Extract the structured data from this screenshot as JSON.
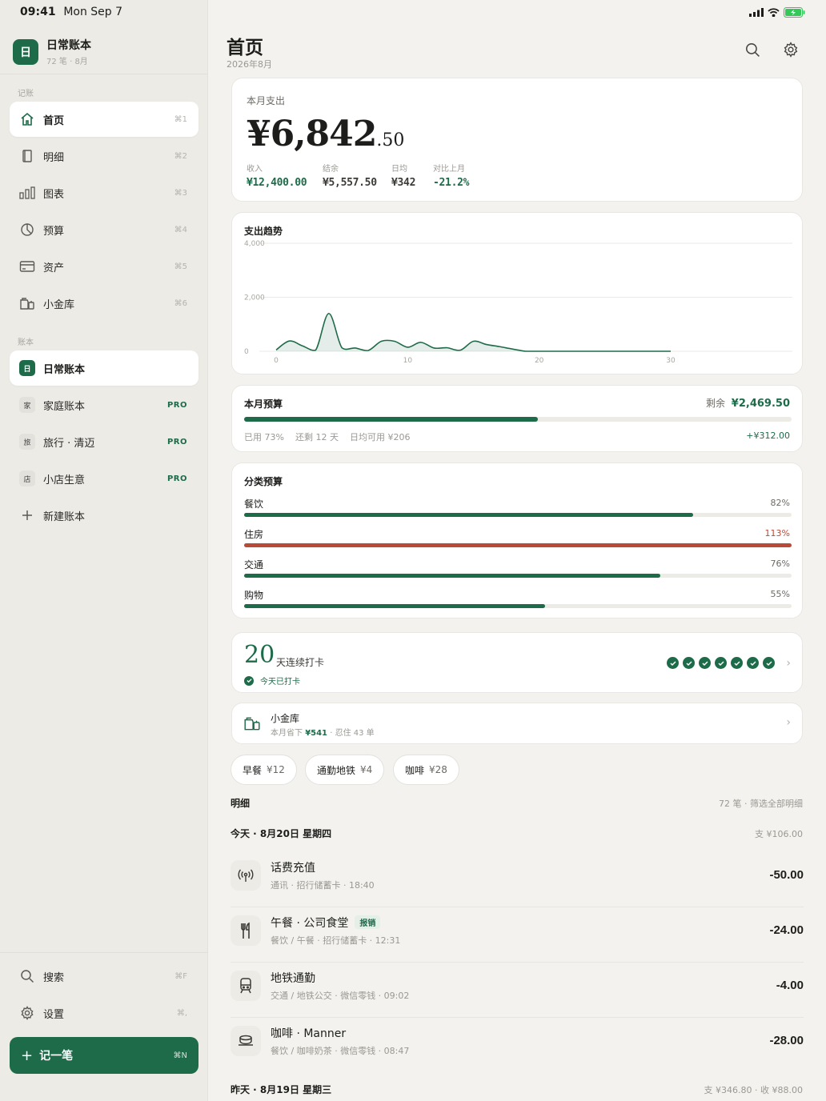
{
  "status": {
    "time": "09:41",
    "date": "Mon Sep 7"
  },
  "sidebar": {
    "book": {
      "logo": "日",
      "name": "日常账本",
      "sub": "72 笔 · 8月"
    },
    "section_record": "记账",
    "nav": [
      {
        "label": "首页",
        "shortcut": "⌘1",
        "icon": "home-icon"
      },
      {
        "label": "明细",
        "shortcut": "⌘2",
        "icon": "book-icon"
      },
      {
        "label": "图表",
        "shortcut": "⌘3",
        "icon": "bar-chart-icon"
      },
      {
        "label": "预算",
        "shortcut": "⌘4",
        "icon": "pie-icon"
      },
      {
        "label": "资产",
        "shortcut": "⌘5",
        "icon": "card-icon"
      },
      {
        "label": "小金库",
        "shortcut": "⌘6",
        "icon": "vault-icon"
      }
    ],
    "section_books": "账本",
    "books": [
      {
        "badge": "日",
        "label": "日常账本",
        "pro": ""
      },
      {
        "badge": "家",
        "label": "家庭账本",
        "pro": "PRO"
      },
      {
        "badge": "旅",
        "label": "旅行 · 清迈",
        "pro": "PRO"
      },
      {
        "badge": "店",
        "label": "小店生意",
        "pro": "PRO"
      }
    ],
    "new_book": "新建账本",
    "search": {
      "label": "搜索",
      "shortcut": "⌘F"
    },
    "settings": {
      "label": "设置",
      "shortcut": "⌘,"
    },
    "add": {
      "label": "记一笔",
      "shortcut": "⌘N"
    }
  },
  "header": {
    "title": "首页",
    "subtitle": "2026年8月"
  },
  "summary": {
    "label": "本月支出",
    "amount_main": "¥6,842",
    "amount_cents": ".50",
    "stats": [
      {
        "label": "收入",
        "value": "¥12,400.00",
        "color": "#1e6b4a"
      },
      {
        "label": "结余",
        "value": "¥5,557.50",
        "color": "#3d3b37"
      },
      {
        "label": "日均",
        "value": "¥342",
        "color": "#3d3b37"
      },
      {
        "label": "对比上月",
        "value": "-21.2%",
        "color": "#1e6b4a"
      }
    ]
  },
  "trend": {
    "title": "支出趋势"
  },
  "chart_data": {
    "type": "area",
    "title": "支出趋势",
    "x": [
      0,
      1,
      2,
      3,
      4,
      5,
      6,
      7,
      8,
      9,
      10,
      11,
      12,
      13,
      14,
      15,
      16,
      17,
      18,
      19,
      20,
      21,
      22,
      23,
      24,
      25,
      26,
      27,
      28,
      29,
      30
    ],
    "values": [
      50,
      380,
      200,
      40,
      1400,
      130,
      120,
      30,
      370,
      370,
      150,
      330,
      120,
      130,
      40,
      370,
      250,
      170,
      80,
      0,
      0,
      0,
      0,
      0,
      0,
      0,
      0,
      0,
      0,
      0,
      0
    ],
    "xticks": [
      "0",
      "10",
      "20",
      "30"
    ],
    "yticks": [
      "0",
      "2,000",
      "4,000"
    ],
    "ylim": [
      0,
      4000
    ],
    "xlim": [
      0,
      30
    ],
    "grid": true,
    "color": "#1e6b4a"
  },
  "budget": {
    "title": "本月预算",
    "remaining_label": "剩余",
    "remaining": "¥2,469.50",
    "progress": 0.73,
    "used": "已用 73%",
    "days_left": "还剩 12 天",
    "daily": "日均可用 ¥206",
    "delta": "+¥312.00"
  },
  "categories": {
    "title": "分类预算",
    "items": [
      {
        "name": "餐饮",
        "pct": "82%",
        "ratio": 0.82,
        "color": "#1e6b4a",
        "pct_color": "#6c6a65"
      },
      {
        "name": "住房",
        "pct": "113%",
        "ratio": 1.0,
        "color": "#b94a38",
        "pct_color": "#b94a38"
      },
      {
        "name": "交通",
        "pct": "76%",
        "ratio": 0.76,
        "color": "#1e6b4a",
        "pct_color": "#6c6a65"
      },
      {
        "name": "购物",
        "pct": "55%",
        "ratio": 0.55,
        "color": "#1e6b4a",
        "pct_color": "#6c6a65"
      }
    ]
  },
  "streak": {
    "days": "20",
    "unit": "天连续打卡",
    "today": "今天已打卡",
    "checks": 7
  },
  "vault": {
    "title": "小金库",
    "sub_prefix": "本月省下",
    "saved": "¥541",
    "sub_suffix": "· 忍住 43 单"
  },
  "chips": [
    {
      "label": "早餐",
      "value": "¥12"
    },
    {
      "label": "通勤地铁",
      "value": "¥4"
    },
    {
      "label": "咖啡",
      "value": "¥28"
    }
  ],
  "detail": {
    "title": "明细",
    "meta": "72 笔 · 筛选全部明细"
  },
  "today": {
    "label": "今天 · 8月20日 星期四",
    "total": "支 ¥106.00"
  },
  "transactions": [
    {
      "icon": "antenna-icon",
      "title": "话费充值",
      "tag": "",
      "sub": "通讯 · 招行储蓄卡 · 18:40",
      "amount": "-50.00"
    },
    {
      "icon": "utensils-icon",
      "title": "午餐 · 公司食堂",
      "tag": "报销",
      "sub": "餐饮 / 午餐 · 招行储蓄卡 · 12:31",
      "amount": "-24.00"
    },
    {
      "icon": "train-icon",
      "title": "地铁通勤",
      "tag": "",
      "sub": "交通 / 地铁公交 · 微信零钱 · 09:02",
      "amount": "-4.00"
    },
    {
      "icon": "coffee-icon",
      "title": "咖啡 · Manner",
      "tag": "",
      "sub": "餐饮 / 咖啡奶茶 · 微信零钱 · 08:47",
      "amount": "-28.00"
    }
  ],
  "yesterday": {
    "label": "昨天 · 8月19日 星期三",
    "total": "支 ¥346.80 · 收 ¥88.00"
  }
}
